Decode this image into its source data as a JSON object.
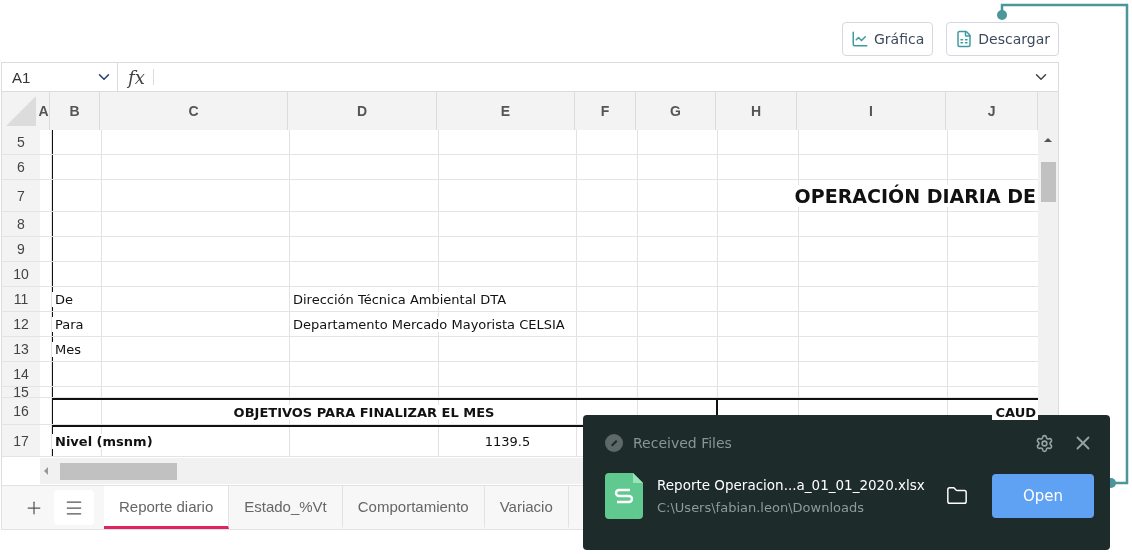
{
  "toolbar": {
    "buttons": [
      {
        "label": "Gráfica",
        "kind": "chart"
      },
      {
        "label": "Descargar",
        "kind": "download"
      }
    ]
  },
  "formula_bar": {
    "cell_ref": "A1",
    "fx": "fx"
  },
  "sheet": {
    "columns": [
      "A",
      "B",
      "C",
      "D",
      "E",
      "F",
      "G",
      "H",
      "I",
      "J"
    ],
    "rows": [
      {
        "number": "5",
        "kind": "plain"
      },
      {
        "number": "6",
        "kind": "plain"
      },
      {
        "number": "7",
        "kind": "title",
        "cells": [
          {},
          {},
          {},
          {},
          {},
          {},
          {},
          {},
          {},
          {
            "text": "OPERACIÓN DIARIA DE",
            "kind": "title",
            "bold": true
          }
        ]
      },
      {
        "number": "8",
        "kind": "plain"
      },
      {
        "number": "9",
        "kind": "plain"
      },
      {
        "number": "10",
        "kind": "plain"
      },
      {
        "number": "11",
        "kind": "plain",
        "cells": [
          {},
          {
            "text": "De",
            "kind": "label",
            "bold": false
          },
          {},
          {
            "text": "Dirección Técnica Ambiental DTA",
            "kind": "label",
            "bold": false
          }
        ]
      },
      {
        "number": "12",
        "kind": "plain",
        "cells": [
          {},
          {
            "text": "Para",
            "kind": "label",
            "bold": false
          },
          {},
          {
            "text": "Departamento Mercado Mayorista CELSIA",
            "kind": "label",
            "bold": false
          }
        ]
      },
      {
        "number": "13",
        "kind": "plain",
        "cells": [
          {},
          {
            "text": "Mes",
            "kind": "label",
            "bold": false
          }
        ]
      },
      {
        "number": "14",
        "kind": "plain"
      },
      {
        "number": "15",
        "kind": "spacer"
      },
      {
        "number": "16",
        "kind": "band",
        "cells": [
          {},
          {},
          {},
          {
            "text": "OBJETIVOS PARA FINALIZAR EL MES",
            "kind": "heading",
            "bold": true
          },
          {},
          {},
          {},
          {},
          {},
          {
            "text": "CAUD",
            "kind": "title",
            "bold": true
          }
        ]
      },
      {
        "number": "17",
        "kind": "tall",
        "cells": [
          {},
          {
            "text": "Nivel (msnm)",
            "kind": "label",
            "bold": true
          },
          {},
          {},
          {
            "text": "1139.5",
            "kind": "number",
            "bold": false
          }
        ]
      }
    ]
  },
  "sheet_tabs": [
    {
      "label": "Reporte diario",
      "selected": true
    },
    {
      "label": "Estado_%Vt",
      "selected": false
    },
    {
      "label": "Comportamiento",
      "selected": false
    },
    {
      "label": "Variacio",
      "selected": false
    }
  ],
  "toast": {
    "title": "Received Files",
    "file_name": "Reporte Operacion...a_01_01_2020.xlsx",
    "path": "C:\\Users\\fabian.leon\\Downloads",
    "action": "Open"
  }
}
